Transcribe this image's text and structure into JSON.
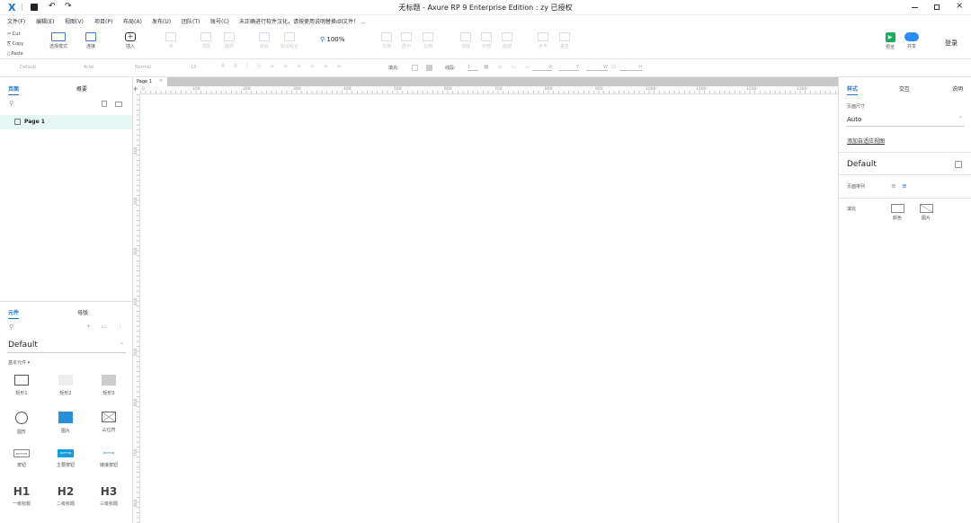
{
  "app": {
    "window_title": "无标题 - Axure RP 9 Enterprise Edition : zy 已授权",
    "logo_glyph": "X"
  },
  "menu": [
    "文件(F)",
    "编辑(E)",
    "视图(V)",
    "项目(P)",
    "布局(A)",
    "发布(U)",
    "团队(T)",
    "账号(C)",
    "未正确进行软件汉化，请按使用说明替换dll文件！ ..."
  ],
  "clipboard": {
    "cut": "Cut",
    "copy": "Copy",
    "paste": "Paste"
  },
  "toolbar": {
    "select_mode": "选择模式",
    "connect": "连接",
    "insert": "插入",
    "zoom": "100%",
    "disabled_labels": [
      "点",
      "顶层",
      "底层",
      "组合",
      "取消组合",
      "左侧",
      "居中",
      "右侧",
      "顶部",
      "中部",
      "底部",
      "水平",
      "垂直"
    ],
    "preview": "预览",
    "share": "共享",
    "login": "登录"
  },
  "format_bar": {
    "style": "Default",
    "font": "Arial",
    "weight": "Normal",
    "size": "13",
    "fill_label": "填充:",
    "line_label": "线段:",
    "line_width": "1",
    "x_label": "X",
    "y_label": "Y",
    "w_label": "W",
    "h_label": "H"
  },
  "pages_panel": {
    "tabs": [
      "页面",
      "概要"
    ],
    "items": [
      "Page 1"
    ]
  },
  "library_panel": {
    "tabs": [
      "元件",
      "母版"
    ],
    "library": "Default",
    "section": "基本元件 ▾",
    "widgets": [
      {
        "label": "矩形1",
        "icon": "rectangle-outline-icon"
      },
      {
        "label": "矩形2",
        "icon": "rectangle-light-icon"
      },
      {
        "label": "矩形3",
        "icon": "rectangle-gray-icon"
      },
      {
        "label": "圆形",
        "icon": "ellipse-icon"
      },
      {
        "label": "图片",
        "icon": "image-icon"
      },
      {
        "label": "占位符",
        "icon": "placeholder-icon"
      },
      {
        "label": "按钮",
        "icon": "button-icon",
        "text": "BUTTON"
      },
      {
        "label": "主要按钮",
        "icon": "primary-button-icon",
        "text": "BUTTON"
      },
      {
        "label": "链接按钮",
        "icon": "link-button-icon",
        "text": "BUTTON"
      },
      {
        "label": "一级标题",
        "icon": "h1-icon",
        "text": "H1"
      },
      {
        "label": "二级标题",
        "icon": "h2-icon",
        "text": "H2"
      },
      {
        "label": "三级标题",
        "icon": "h3-icon",
        "text": "H3"
      }
    ]
  },
  "canvas": {
    "tab": "Page 1",
    "ruler_h": [
      "0",
      "100",
      "200",
      "300",
      "400",
      "500",
      "600",
      "700",
      "800",
      "900",
      "1000",
      "1100",
      "1200",
      "1300"
    ],
    "ruler_v": [
      "100",
      "200",
      "300",
      "400",
      "500",
      "600",
      "700",
      "800"
    ]
  },
  "style_panel": {
    "tabs": [
      "样式",
      "交互",
      "说明"
    ],
    "page_size_label": "页面尺寸",
    "page_size": "Auto",
    "adaptive_link": "添加自适应视图",
    "style_name": "Default",
    "align_label": "页面排列",
    "fill_label": "填充",
    "fill_color": "颜色",
    "fill_image": "图片"
  },
  "colors": {
    "accent": "#1a73c9",
    "preview_green": "#1aad5c",
    "share_blue": "#2a8cf0"
  }
}
